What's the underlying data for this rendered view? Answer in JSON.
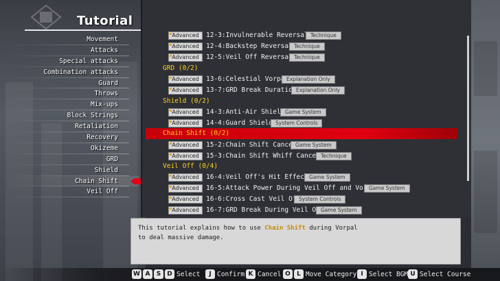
{
  "header": {
    "title": "Tutorial"
  },
  "categories": [
    {
      "label": "Movement"
    },
    {
      "label": "Attacks"
    },
    {
      "label": "Special attacks"
    },
    {
      "label": "Combination attacks"
    },
    {
      "label": "Guard"
    },
    {
      "label": "Throws"
    },
    {
      "label": "Mix-ups"
    },
    {
      "label": "Block Strings"
    },
    {
      "label": "Retaliation"
    },
    {
      "label": "Recovery"
    },
    {
      "label": "Okizeme"
    },
    {
      "label": "GRD"
    },
    {
      "label": "Shield"
    },
    {
      "label": "Chain Shift"
    },
    {
      "label": "Veil Off"
    }
  ],
  "lessons": {
    "r0": {
      "badge": "Advanced",
      "name": "12-3:Invulnerable Reversals",
      "tag": "Technique"
    },
    "r1": {
      "badge": "Advanced",
      "name": "12-4:Backstep Reversal",
      "tag": "Technique"
    },
    "r2": {
      "badge": "Advanced",
      "name": "12-5:Veil Off Reversal",
      "tag": "Technique"
    },
    "s_grd": "GRD  (0/2)",
    "r3": {
      "badge": "Advanced",
      "name": "13-6:Celestial Vorpal",
      "tag": "Explanation Only"
    },
    "r4": {
      "badge": "Advanced",
      "name": "13-7:GRD Break Duration",
      "tag": "Explanation Only"
    },
    "s_shield": "Shield  (0/2)",
    "r5": {
      "badge": "Advanced",
      "name": "14-3:Anti-Air Shield",
      "tag": "Game System"
    },
    "r6": {
      "badge": "Advanced",
      "name": "14-4:Guard Shield",
      "tag": "System Controls"
    },
    "s_chain": "Chain Shift  (0/2)",
    "r7": {
      "badge": "Advanced",
      "name": "15-2:Chain Shift Cancel",
      "tag": "Game System"
    },
    "r8": {
      "badge": "Advanced",
      "name": "15-3:Chain Shift Whiff Cancel",
      "tag": "Technique"
    },
    "s_veil": "Veil Off  (0/4)",
    "r9": {
      "badge": "Advanced",
      "name": "16-4:Veil Off's Hit Effects",
      "tag": "Game System"
    },
    "r10": {
      "badge": "Advanced",
      "name": "16-5:Attack Power During Veil Off and Vorpal",
      "tag": "Game System"
    },
    "r11": {
      "badge": "Advanced",
      "name": "16-6:Cross Cast Veil Off",
      "tag": "System Controls"
    },
    "r12": {
      "badge": "Advanced",
      "name": "16-7:GRD Break During Veil Off",
      "tag": "Game System"
    }
  },
  "description": {
    "pre": "This tutorial explains how to use ",
    "highlight": "Chain Shift",
    "post": " during Vorpal",
    "line2": "to deal massive damage."
  },
  "controls": {
    "wasd": {
      "keys": [
        "W",
        "A",
        "S",
        "D"
      ],
      "label": "Select"
    },
    "confirm": {
      "key": "J",
      "label": "Confirm"
    },
    "cancel": {
      "key": "K",
      "label": "Cancel"
    },
    "category": {
      "keys": [
        "O",
        "L"
      ],
      "label": "Move Category"
    },
    "bgm": {
      "key": "I",
      "label": "Select BGM"
    },
    "course": {
      "key": "U",
      "label": "Select Course"
    }
  },
  "colors": {
    "section": "#ffd21a",
    "selection": "#e00010",
    "highlight_text": "#c78a00"
  },
  "icons": {
    "emblem": "crest-emblem-icon",
    "cursor": "red-arrow-pointer-icon",
    "badge": "advanced-badge-icon"
  }
}
